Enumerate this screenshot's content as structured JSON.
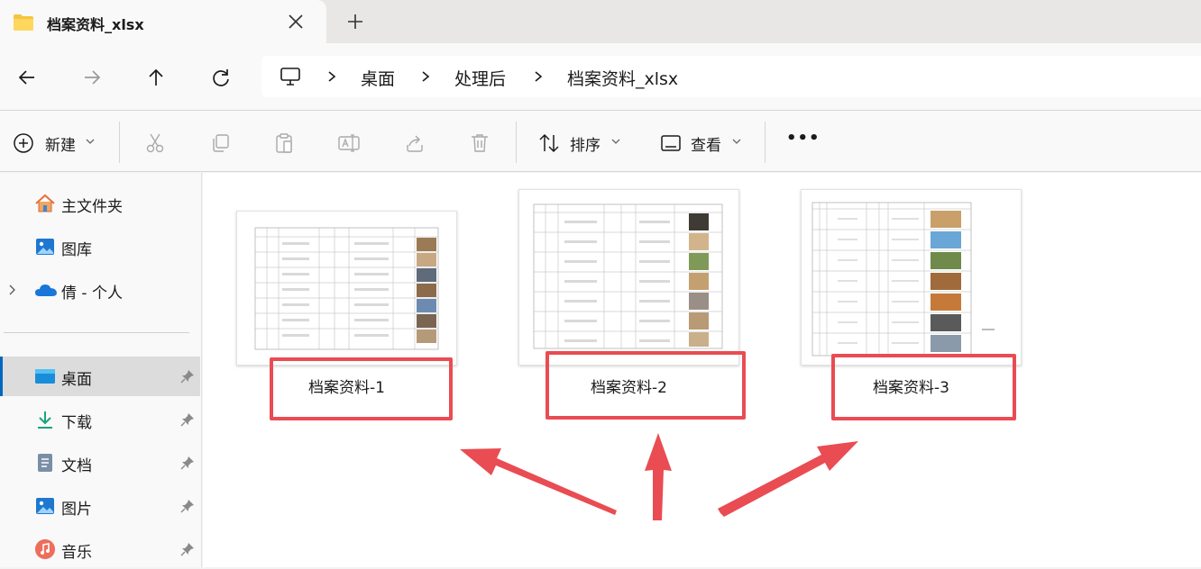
{
  "window": {
    "tab_title": "档案资料_xlsx",
    "icons": {
      "folder": "folder-icon",
      "close": "close-icon",
      "new_tab": "plus-icon"
    }
  },
  "address_bar": {
    "crumbs": [
      "桌面",
      "处理后",
      "档案资料_xlsx"
    ],
    "root_icon": "monitor-icon"
  },
  "nav": {
    "back": "back-arrow-icon",
    "forward": "forward-arrow-icon",
    "up": "up-arrow-icon",
    "refresh": "refresh-icon"
  },
  "toolbar": {
    "new_label": "新建",
    "sort_label": "排序",
    "view_label": "查看",
    "more_label": "•••",
    "icons": [
      "cut-icon",
      "copy-icon",
      "paste-icon",
      "rename-icon",
      "share-icon",
      "delete-icon"
    ]
  },
  "sidebar": {
    "items": [
      {
        "label": "主文件夹",
        "icon": "home-icon"
      },
      {
        "label": "图库",
        "icon": "gallery-icon"
      },
      {
        "label": "倩 - 个人",
        "icon": "onedrive-cloud-icon"
      },
      {
        "label": "桌面",
        "icon": "desktop-icon",
        "selected": true
      },
      {
        "label": "下载",
        "icon": "download-icon"
      },
      {
        "label": "文档",
        "icon": "document-icon"
      },
      {
        "label": "图片",
        "icon": "pictures-icon"
      },
      {
        "label": "音乐",
        "icon": "music-icon"
      }
    ]
  },
  "files": [
    {
      "name": "档案资料-1"
    },
    {
      "name": "档案资料-2"
    },
    {
      "name": "档案资料-3"
    }
  ],
  "colors": {
    "highlight": "#e94c52",
    "accent": "#0067c0"
  }
}
